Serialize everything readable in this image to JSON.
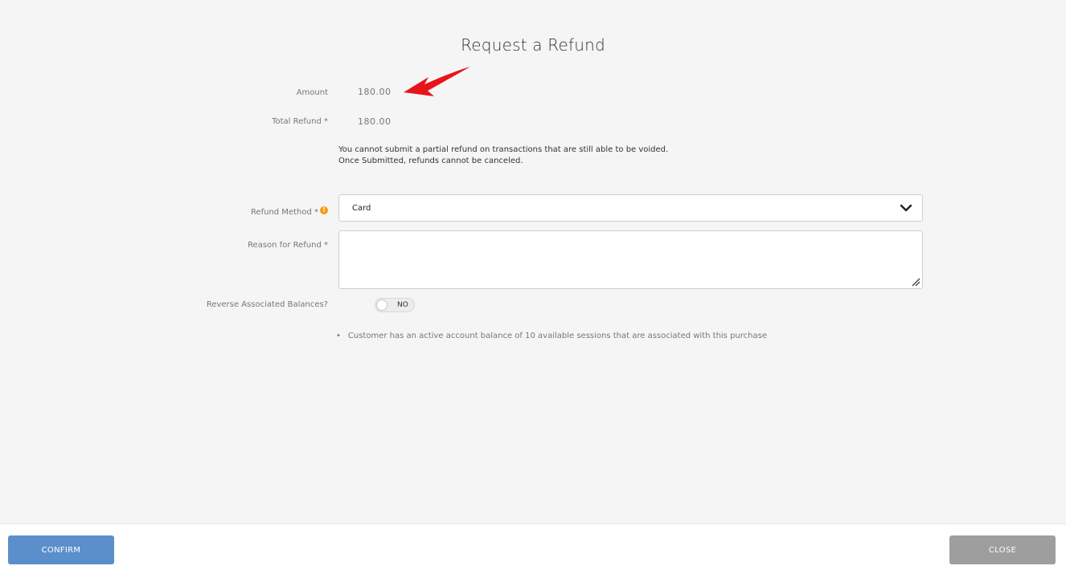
{
  "dialog": {
    "title": "Request a Refund"
  },
  "amount": {
    "label": "Amount",
    "value": "180.00"
  },
  "total_refund": {
    "label": "Total Refund *",
    "value": "180.00"
  },
  "notice": {
    "line1": "You cannot submit a partial refund on transactions that are still able to be voided.",
    "line2": "Once Submitted, refunds cannot be canceled."
  },
  "refund_method": {
    "label": "Refund Method *",
    "info_icon": "!",
    "selected": "Card"
  },
  "reason": {
    "label": "Reason for Refund *",
    "value": ""
  },
  "reverse_balances": {
    "label": "Reverse Associated Balances?",
    "toggle_text": "NO"
  },
  "balance_note": {
    "bullet": "•",
    "text": "Customer has an active account balance of 10 available sessions that are associated with this purchase"
  },
  "footer": {
    "confirm_label": "CONFIRM",
    "close_label": "CLOSE"
  },
  "colors": {
    "confirm": "#5b8fcc",
    "close": "#9e9e9e",
    "info": "#f39c12",
    "arrow": "#e8141b"
  }
}
